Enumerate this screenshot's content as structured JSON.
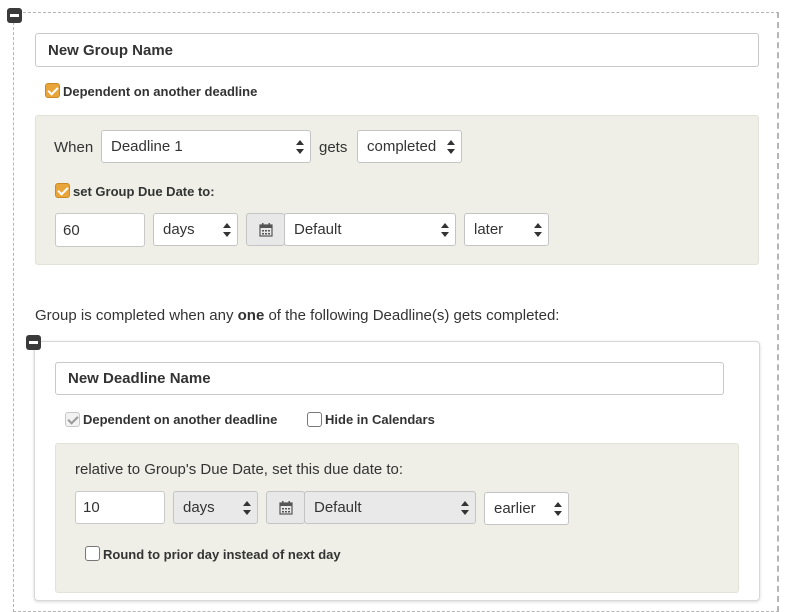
{
  "group": {
    "name_value": "New Group Name",
    "dependent_label": "Dependent on another deadline",
    "dependent_checked": true,
    "when_label": "When",
    "deadline_select": "Deadline 1",
    "gets_label": "gets",
    "status_select": "completed",
    "set_due_label": "set Group Due Date to:",
    "set_due_checked": true,
    "amount_value": "60",
    "unit_select": "days",
    "calendar_icon": "calendar-icon",
    "calendar_select": "Default",
    "direction_select": "later"
  },
  "completion": {
    "prefix": "Group is completed when any ",
    "emphasis": "one",
    "suffix": " of the following Deadline(s) gets completed:"
  },
  "deadline": {
    "name_value": "New Deadline Name",
    "dependent_label": "Dependent on another deadline",
    "dependent_checked": true,
    "hide_label": "Hide in Calendars",
    "hide_checked": false,
    "relative_label": "relative to Group's Due Date, set this due date to:",
    "amount_value": "10",
    "unit_select": "days",
    "calendar_icon": "calendar-icon",
    "calendar_select": "Default",
    "direction_select": "earlier",
    "round_label": "Round to prior day instead of next day",
    "round_checked": false
  },
  "colors": {
    "accent_checkbox": "#e9a53a",
    "panel_bg": "#efefe7"
  }
}
